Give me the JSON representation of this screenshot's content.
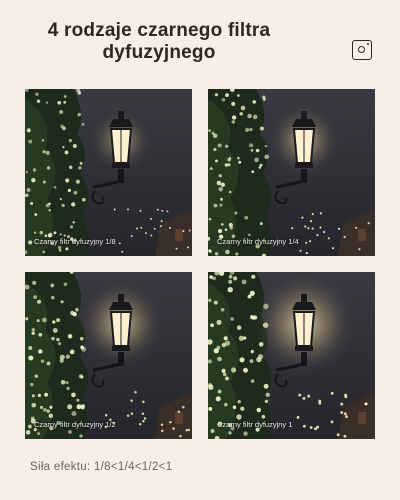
{
  "header": {
    "title_line1": "4 rodzaje czarnego filtra",
    "title_line2": "dyfuzyjnego",
    "brand_icon": "instagram-icon"
  },
  "panels": [
    {
      "label": "Czarny filtr dyfuzyjny 1/8"
    },
    {
      "label": "Czarny filtr dyfuzyjny 1/4"
    },
    {
      "label": "Czarny filtr dyfuzyjny 1/2"
    },
    {
      "label": "Czarny filtr dyfuzyjny 1"
    }
  ],
  "footer": {
    "effect_text": "Siła efektu: 1/8<1/4<1/2<1"
  },
  "colors": {
    "background": "#f6efe6",
    "text": "#2e2620",
    "muted": "#6d655d"
  }
}
